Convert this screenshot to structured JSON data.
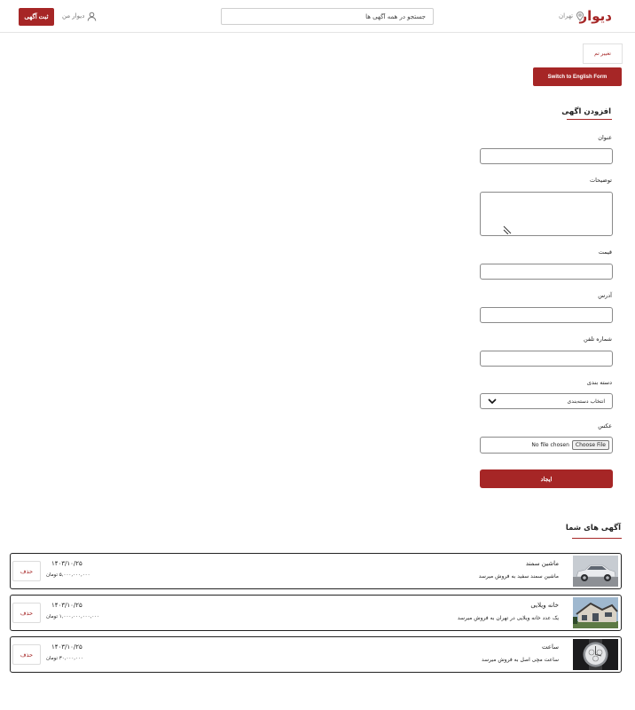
{
  "header": {
    "logo": "دیوار",
    "city": "تهران",
    "search_placeholder": "جستجو در همه آگهی ها",
    "my_divar": "دیوار من",
    "post_ad": "ثبت آگهی"
  },
  "theme_button": "تغییر تم",
  "lang_button": "Switch to English Form",
  "form": {
    "title": "افزودن اگهی",
    "title_label": "عنوان",
    "description_label": "توضیحات",
    "price_label": "قیمت",
    "address_label": "آدرس",
    "phone_label": "شماره تلفن",
    "category_label": "دسته بندی",
    "category_selected": "انتخاب دسته‌بندی",
    "photo_label": "عکس",
    "file_button": "Choose File",
    "file_status": "No file chosen",
    "submit": "ایجاد"
  },
  "ads": {
    "title": "آگهی های شما",
    "items": [
      {
        "title": "ماشین سمند",
        "description": "ماشین سمند سفید به فروش میرسد",
        "date": "۱۴۰۳/۱۰/۲۵",
        "price": "۵,۰۰۰,۰۰۰,۰۰۰ تومان",
        "delete": "حذف",
        "thumb": "car"
      },
      {
        "title": "خانه ویلایی",
        "description": "یک عدد خانه ویلایی در تهران به فروش میرسد",
        "date": "۱۴۰۳/۱۰/۲۵",
        "price": "۱,۰۰۰,۰۰۰,۰۰۰,۰۰۰ تومان",
        "delete": "حذف",
        "thumb": "house"
      },
      {
        "title": "ساعت",
        "description": "ساعت مچی اصل به فروش میرسد",
        "date": "۱۴۰۳/۱۰/۲۵",
        "price": "۳۰,۰۰۰,۰۰۰ تومان",
        "delete": "حذف",
        "thumb": "watch"
      }
    ]
  }
}
